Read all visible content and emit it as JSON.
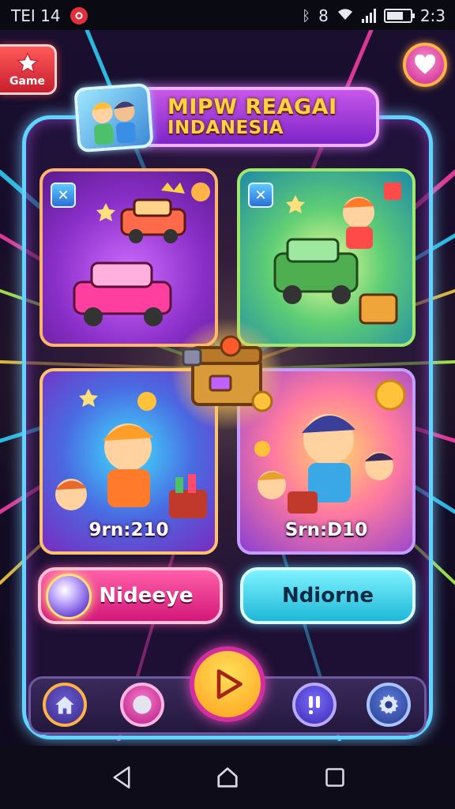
{
  "status_bar": {
    "carrier": "TEI 14",
    "bluetooth": "8",
    "time": "2:3",
    "battery_level": 0.7,
    "icons": [
      "notification-icon",
      "bluetooth-icon",
      "wifi-icon",
      "signal-icon",
      "battery-icon"
    ]
  },
  "top": {
    "game_button_label": "Game",
    "heart_icon": "heart-icon"
  },
  "title": {
    "line1": "MIPW REAGAI",
    "line2": "INDANESIA"
  },
  "cards": [
    {
      "name": "vehicles-card",
      "label": ""
    },
    {
      "name": "truck-card",
      "label": ""
    },
    {
      "name": "kids-party-card",
      "label": "9rn:210"
    },
    {
      "name": "celebration-card",
      "label": "Srn:D10"
    }
  ],
  "actions": {
    "left_label": "Nideeye",
    "right_label": "Ndiorne"
  },
  "bottom_nav": [
    "home-icon",
    "record-icon",
    "play-icon",
    "alert-icon",
    "settings-icon"
  ],
  "colors": {
    "frame": "#5fd4ff",
    "title_text": "#ffd33a",
    "pink_button": "#d3177a",
    "cyan_button": "#1fb8d8",
    "play_button": "#ffb020"
  }
}
